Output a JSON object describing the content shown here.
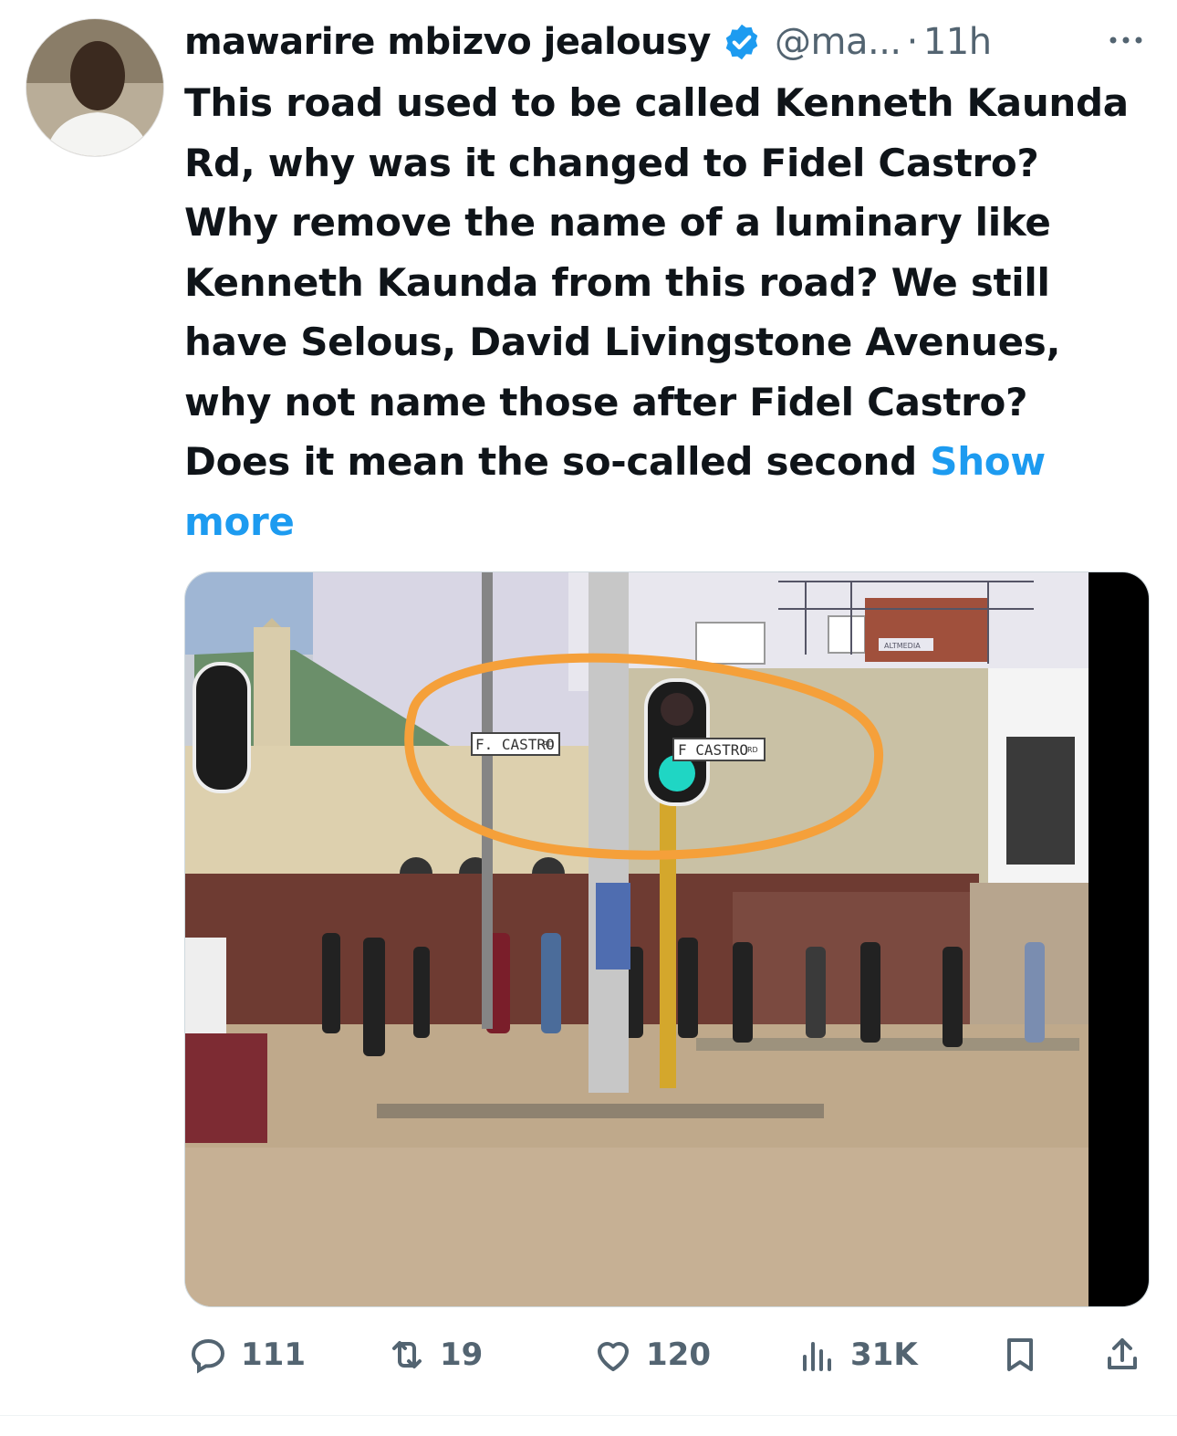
{
  "tweet": {
    "author_name": "mawarire mbizvo jealousy",
    "handle": "@ma...",
    "separator": "·",
    "time": "11h",
    "text": "This road used to be called Kenneth Kaunda Rd, why was it changed to Fidel Castro? Why remove the name of a luminary like Kenneth Kaunda from this road? We still have Selous, David Livingstone Avenues, why not name those after Fidel Castro? Does it mean the so-called second",
    "show_more": "Show more"
  },
  "media": {
    "sign_left": "F. CASTRO",
    "sign_left_suffix": "RD",
    "sign_right": "F CASTRO",
    "sign_right_suffix": "RD",
    "billboard": "ALTMEDIA"
  },
  "actions": {
    "replies": "111",
    "reposts": "19",
    "likes": "120",
    "views": "31K"
  },
  "colors": {
    "accent": "#1d9bf0",
    "muted": "#536471",
    "annotation": "#f5a03a"
  },
  "icons": [
    "verified-badge-icon",
    "more-icon",
    "reply-icon",
    "repost-icon",
    "like-icon",
    "views-icon",
    "bookmark-icon",
    "share-icon"
  ]
}
